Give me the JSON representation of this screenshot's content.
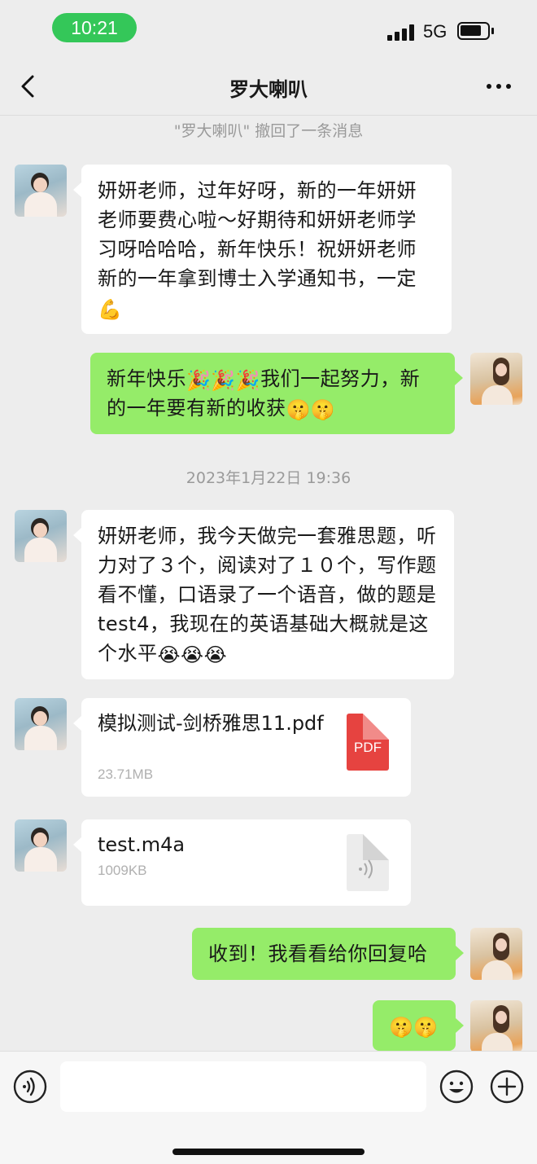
{
  "status_bar": {
    "time": "10:21",
    "network": "5G",
    "battery_level": 0.8
  },
  "header": {
    "title": "罗大喇叭"
  },
  "system": {
    "recall_notice": "\"罗大喇叭\" 撤回了一条消息",
    "timestamp": "2023年1月22日 19:36"
  },
  "messages": {
    "m1": "妍妍老师，过年好呀，新的一年妍妍老师要费心啦～好期待和妍妍老师学习呀哈哈哈，新年快乐！祝妍妍老师新的一年拿到博士入学通知书，一定",
    "m1_emoji": "💪",
    "m2_a": "新年快乐",
    "m2_emoji_a": "🎉🎉🎉",
    "m2_b": "我们一起努力，新的一年要有新的收获",
    "m2_emoji_b": "🤫🤫",
    "m3": "妍妍老师，我今天做完一套雅思题，听力对了３个，阅读对了１０个，写作题看不懂，口语录了一个语音，做的题是test4，我现在的英语基础大概就是这个水平",
    "m3_emoji": "😭😭😭",
    "file1": {
      "name": "模拟测试-剑桥雅思11.pdf",
      "size": "23.71MB",
      "type_label": "PDF"
    },
    "file2": {
      "name": "test.m4a",
      "size": "1009KB"
    },
    "m4": "收到！我看看给你回复哈",
    "m5_emoji": "🤫🤫"
  },
  "input": {
    "placeholder": ""
  },
  "icons": {
    "back": "chevron-left-icon",
    "more": "more-dots-icon",
    "voice": "voice-icon",
    "emoji": "smiley-icon",
    "plus": "plus-icon"
  },
  "colors": {
    "outgoing_bubble": "#95ec69",
    "incoming_bubble": "#ffffff",
    "pdf": "#e64340",
    "time_pill": "#34c759"
  }
}
